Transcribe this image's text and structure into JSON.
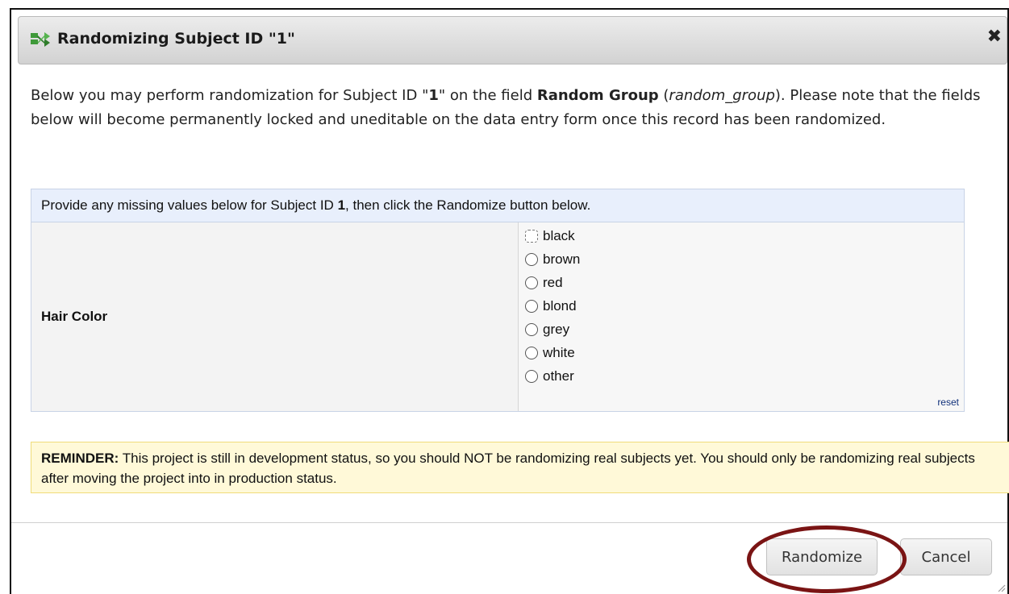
{
  "dialog": {
    "title": "Randomizing Subject ID \"1\"",
    "close_icon": "close-x-icon"
  },
  "intro": {
    "part1": "Below you may perform randomization for Subject ID \"",
    "subject_id": "1",
    "part2": "\" on the field ",
    "field_label": "Random Group",
    "part3": " (",
    "field_var": "random_group",
    "part4": "). Please note that the fields below will become permanently locked and uneditable on the data entry form once this record has been randomized."
  },
  "form": {
    "header_part1": "Provide any missing values below for Subject ID ",
    "header_id": "1",
    "header_part2": ", then click the Randomize button below.",
    "field_label": "Hair Color",
    "options": [
      "black",
      "brown",
      "red",
      "blond",
      "grey",
      "white",
      "other"
    ],
    "reset_label": "reset"
  },
  "reminder": {
    "label": "REMINDER:",
    "text": " This project is still in development status, so you should NOT be randomizing real subjects yet. You should only be randomizing real subjects after moving the project into in production status."
  },
  "buttons": {
    "randomize": "Randomize",
    "cancel": "Cancel"
  },
  "colors": {
    "highlight_ring": "#7a1414",
    "header_bg": "#e8effc",
    "reminder_bg": "#fff9d8"
  }
}
